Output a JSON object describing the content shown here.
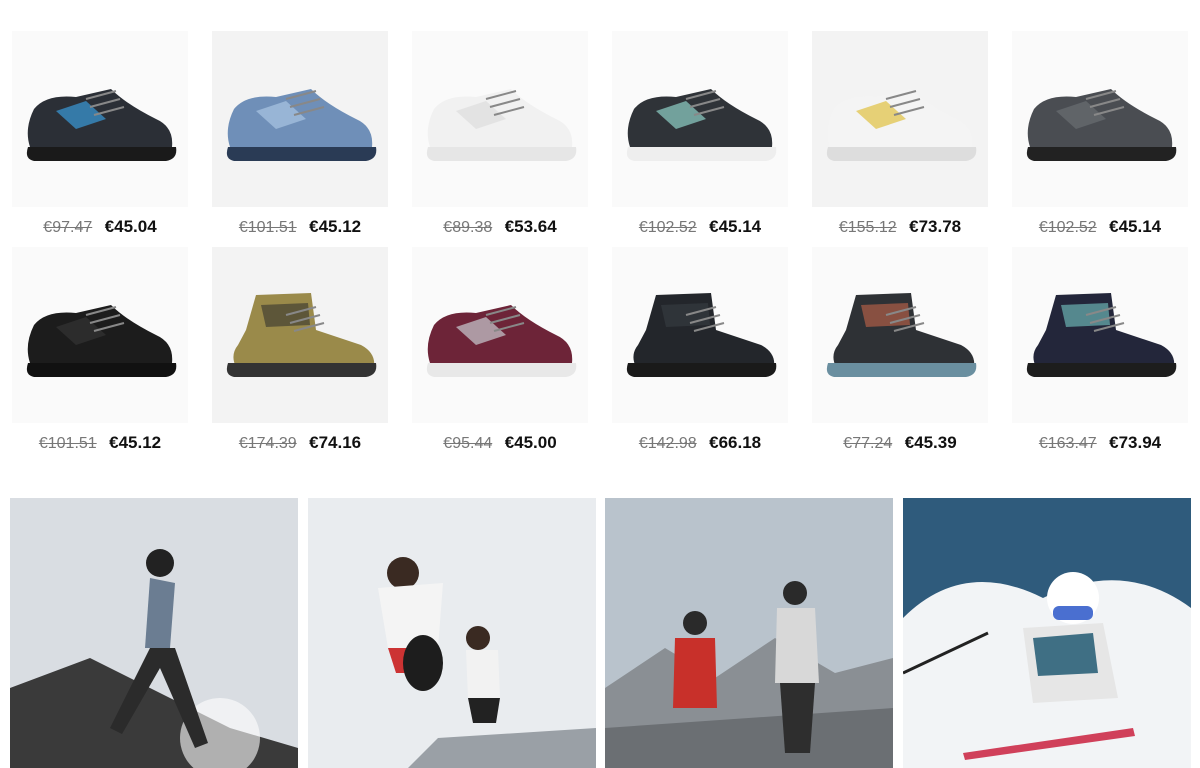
{
  "products": [
    {
      "old_price": "€97.47",
      "new_price": "€45.04",
      "icon": "shoe-hiking-low-grey-blue",
      "color": "#2b2f36",
      "accent": "#3a9ad9",
      "sole": "#1a1a1a"
    },
    {
      "old_price": "€101.51",
      "new_price": "€45.12",
      "icon": "shoe-trail-light-blue",
      "color": "#6f8fb8",
      "accent": "#a9c4e3",
      "sole": "#2a3b55"
    },
    {
      "old_price": "€89.38",
      "new_price": "€53.64",
      "icon": "shoe-running-white",
      "color": "#f1f1f1",
      "accent": "#dddddd",
      "sole": "#e6e6e6"
    },
    {
      "old_price": "€102.52",
      "new_price": "€45.14",
      "icon": "shoe-hiking-mint",
      "color": "#2f3338",
      "accent": "#8fd0c8",
      "sole": "#eeeeee"
    },
    {
      "old_price": "€155.12",
      "new_price": "€73.78",
      "icon": "shoe-trail-white",
      "color": "#f4f4f4",
      "accent": "#e0c040",
      "sole": "#dddddd"
    },
    {
      "old_price": "€102.52",
      "new_price": "€45.14",
      "icon": "shoe-hiking-dark-grey",
      "color": "#4a4d52",
      "accent": "#6a6d72",
      "sole": "#222222"
    },
    {
      "old_price": "€101.51",
      "new_price": "€45.12",
      "icon": "shoe-trail-black",
      "color": "#1c1c1c",
      "accent": "#333333",
      "sole": "#111111"
    },
    {
      "old_price": "€174.39",
      "new_price": "€74.16",
      "icon": "boot-hiking-olive",
      "color": "#9a8a4a",
      "accent": "#2b2b2b",
      "sole": "#333333"
    },
    {
      "old_price": "€95.44",
      "new_price": "€45.00",
      "icon": "shoe-burgundy",
      "color": "#6d2438",
      "accent": "#c9ccd1",
      "sole": "#e8e8e8"
    },
    {
      "old_price": "€142.98",
      "new_price": "€66.18",
      "icon": "boot-winter-black",
      "color": "#23262b",
      "accent": "#3b3f45",
      "sole": "#1a1a1a"
    },
    {
      "old_price": "€77.24",
      "new_price": "€45.39",
      "icon": "boot-kids-grey-orange",
      "color": "#2e3135",
      "accent": "#d46a4a",
      "sole": "#6a8fa0"
    },
    {
      "old_price": "€163.47",
      "new_price": "€73.94",
      "icon": "boot-hiking-navy-mint",
      "color": "#23263a",
      "accent": "#7fd9d3",
      "sole": "#1d1d1d"
    }
  ],
  "banners": [
    {
      "icon": "trail-runner-woman-photo",
      "sky": "#d9dde2",
      "ground": "#3a3a3a"
    },
    {
      "icon": "road-runners-photo",
      "sky": "#e9ecef",
      "ground": "#9aa0a6"
    },
    {
      "icon": "mountain-hikers-photo",
      "sky": "#b9c3cc",
      "ground": "#6b6f73"
    },
    {
      "icon": "skier-snow-photo",
      "sky": "#2f5b7c",
      "ground": "#f2f4f6"
    }
  ]
}
